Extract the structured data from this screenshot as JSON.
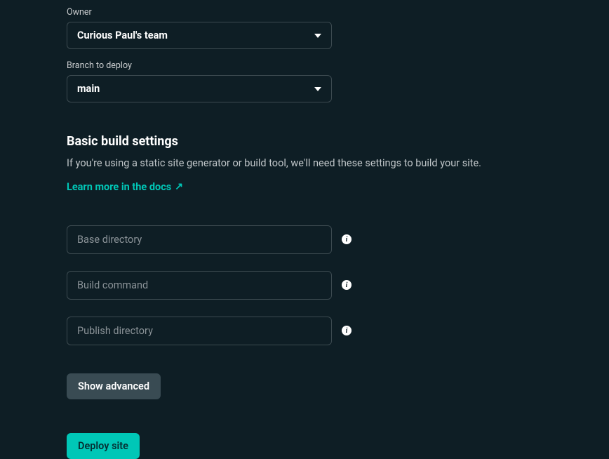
{
  "owner": {
    "label": "Owner",
    "value": "Curious Paul's team"
  },
  "branch": {
    "label": "Branch to deploy",
    "value": "main"
  },
  "buildSettings": {
    "heading": "Basic build settings",
    "description": "If you're using a static site generator or build tool, we'll need these settings to build your site.",
    "learnMore": "Learn more in the docs"
  },
  "inputs": {
    "baseDirectory": {
      "placeholder": "Base directory"
    },
    "buildCommand": {
      "placeholder": "Build command"
    },
    "publishDirectory": {
      "placeholder": "Publish directory"
    }
  },
  "buttons": {
    "showAdvanced": "Show advanced",
    "deploySite": "Deploy site"
  },
  "icons": {
    "info": "i"
  }
}
